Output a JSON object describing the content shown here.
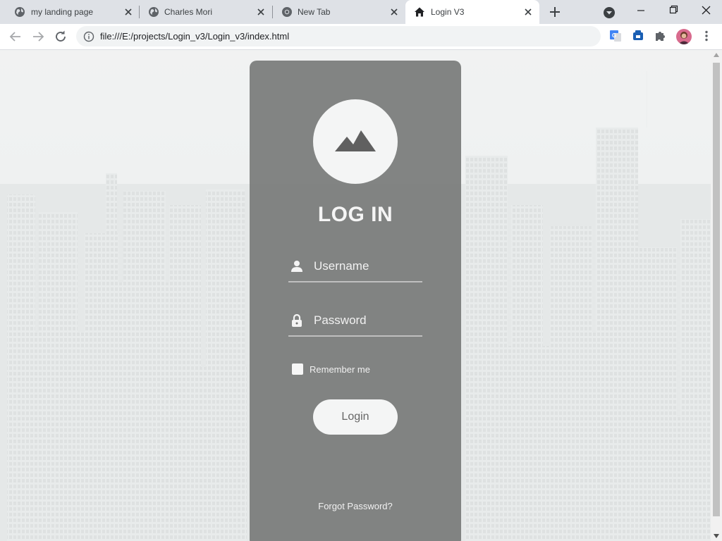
{
  "browser": {
    "tabs": [
      {
        "title": "my landing page",
        "icon": "globe-icon",
        "active": false
      },
      {
        "title": "Charles Mori",
        "icon": "globe-icon",
        "active": false
      },
      {
        "title": "New Tab",
        "icon": "chrome-icon",
        "active": false
      },
      {
        "title": "Login V3",
        "icon": "home-icon",
        "active": true
      }
    ],
    "address_url": "file:///E:/projects/Login_v3/Login_v3/index.html"
  },
  "login": {
    "title": "LOG IN",
    "username_placeholder": "Username",
    "password_placeholder": "Password",
    "remember_label": "Remember me",
    "login_button": "Login",
    "forgot_link": "Forgot Password?"
  },
  "colors": {
    "card_bg": "#727271",
    "page_bg": "#eceeee",
    "accent_text": "#f5f5f5"
  }
}
